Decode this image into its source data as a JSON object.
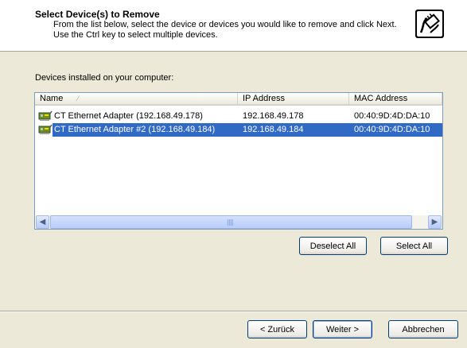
{
  "header": {
    "title": "Select Device(s) to Remove",
    "subtitle": "From the list below, select the device or devices you would like to remove and click Next. Use the Ctrl key to select multiple devices.",
    "icon": "network-cable-icon"
  },
  "devices_label": "Devices installed on your computer:",
  "columns": [
    {
      "label": "Name",
      "sort": "ascending"
    },
    {
      "label": "IP Address"
    },
    {
      "label": "MAC Address"
    }
  ],
  "rows": [
    {
      "name": "CT Ethernet Adapter (192.168.49.178)",
      "ip": "192.168.49.178",
      "mac": "00:40:9D:4D:DA:10",
      "selected": false
    },
    {
      "name": "CT Ethernet Adapter #2 (192.168.49.184)",
      "ip": "192.168.49.184",
      "mac": "00:40:9D:4D:DA:10",
      "selected": true
    }
  ],
  "buttons": {
    "deselect_all": "Deselect All",
    "select_all": "Select All",
    "back": "< Zurück",
    "next": "Weiter >",
    "cancel": "Abbrechen"
  },
  "colors": {
    "selection": "#316ac5",
    "dialog_bg": "#ece9d8",
    "button_border": "#003c74"
  }
}
